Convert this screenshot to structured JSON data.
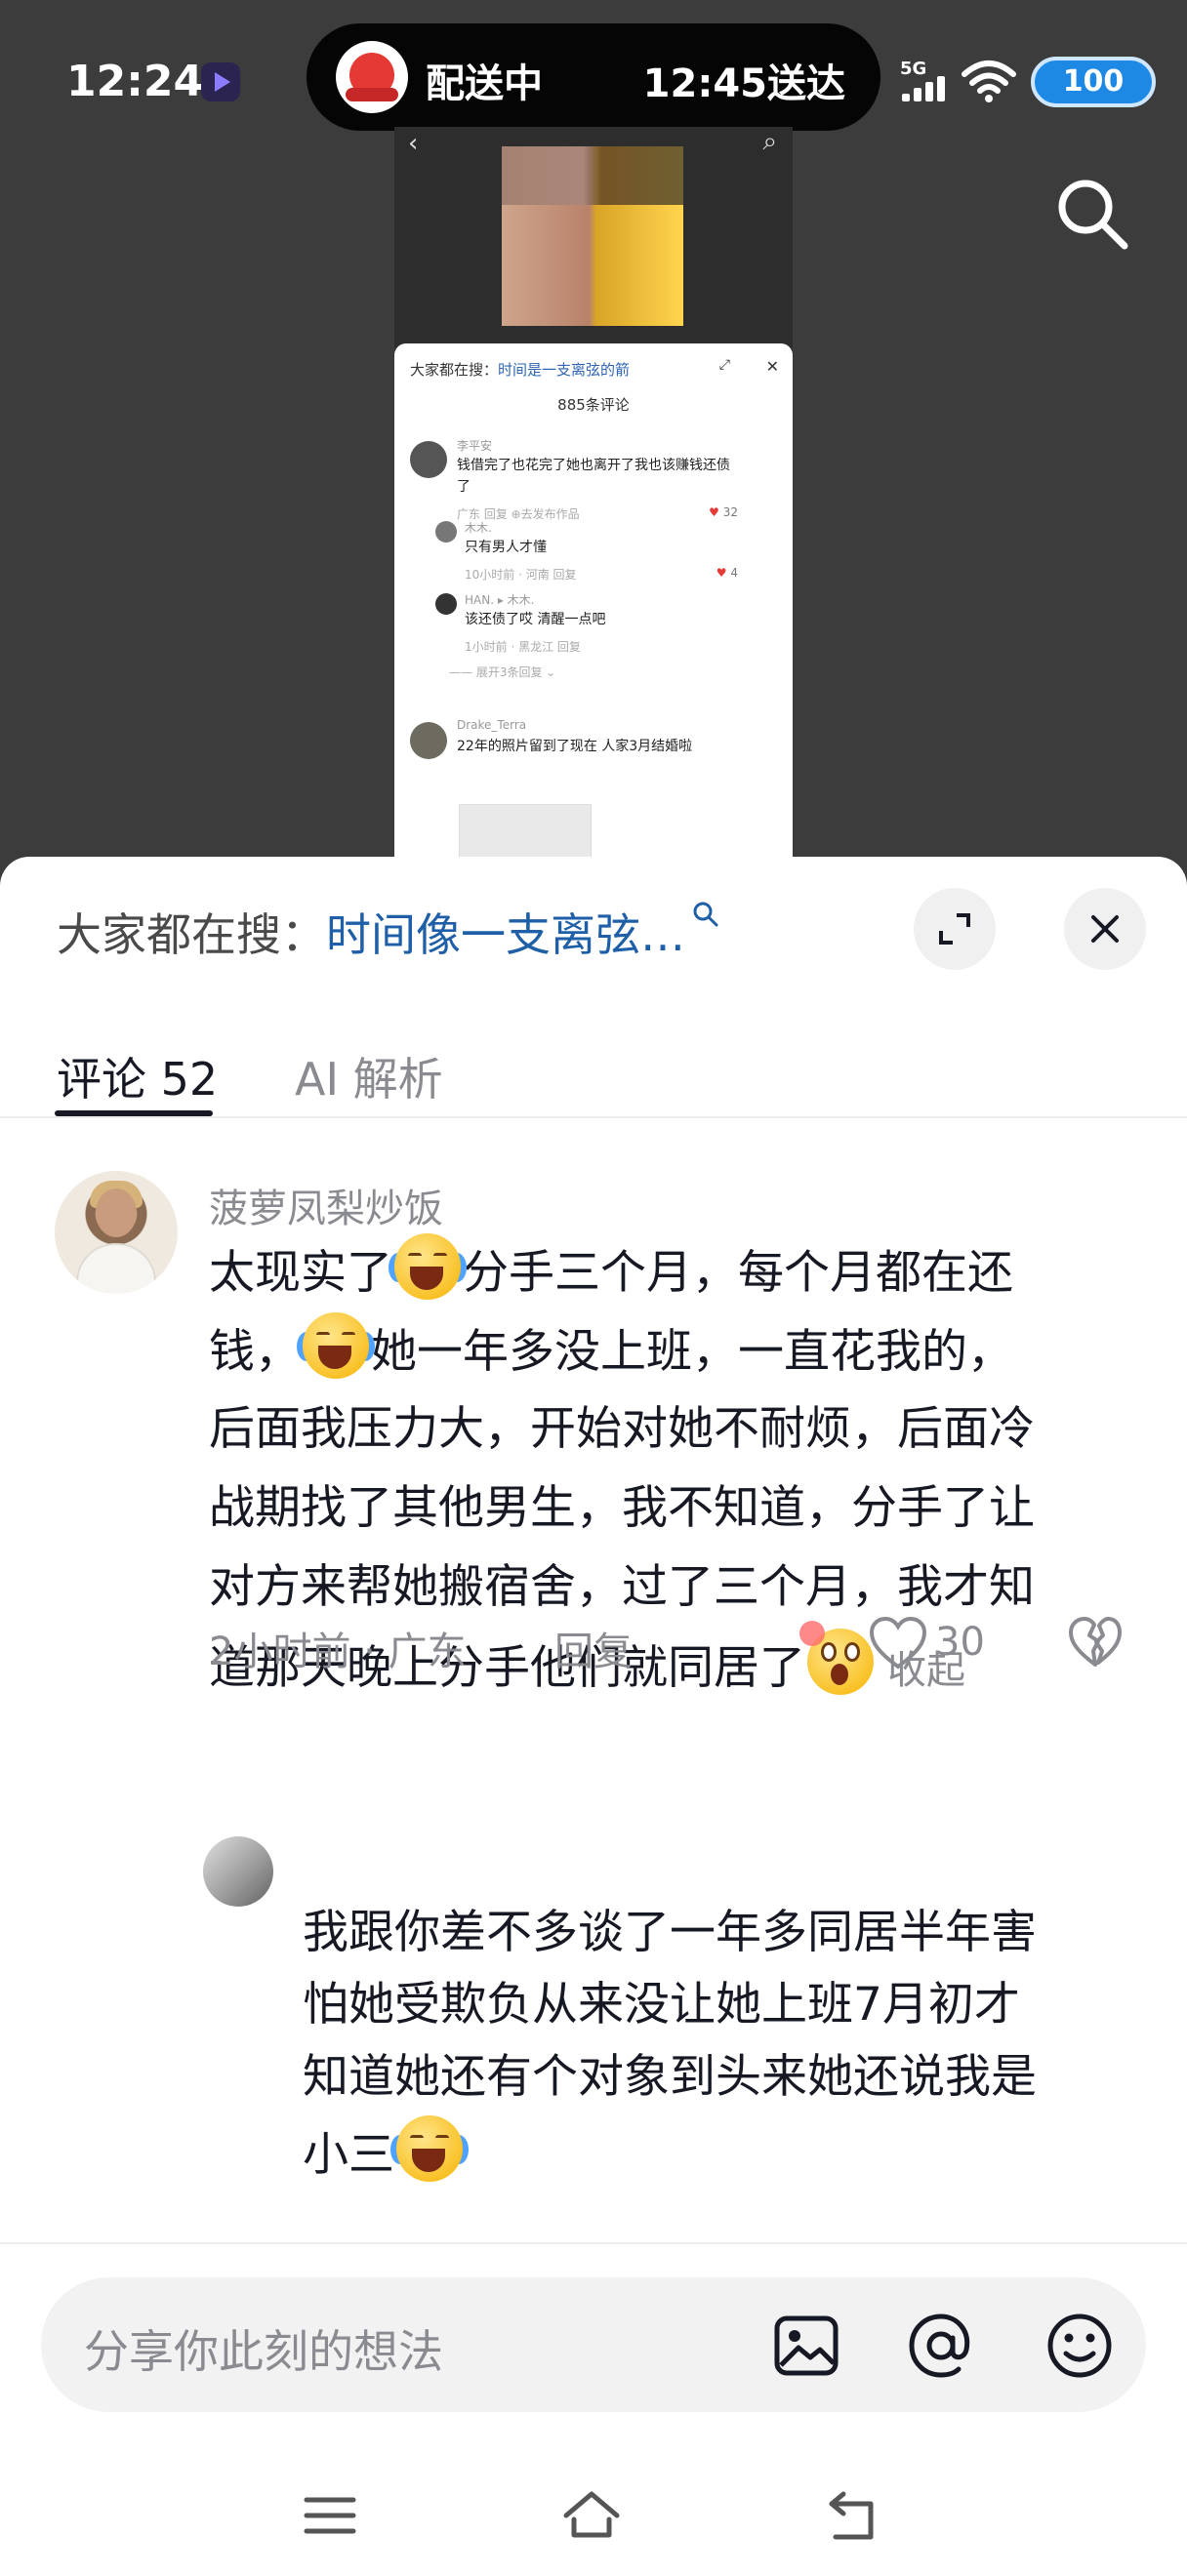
{
  "status_bar": {
    "time": "12:24",
    "network": "5G",
    "battery": "100"
  },
  "live_activity": {
    "status": "配送中",
    "eta": "12:45送达"
  },
  "background_preview": {
    "search_label": "大家都在搜：",
    "search_term": "时间是一支离弦的箭",
    "comment_count": "885条评论",
    "comments": [
      {
        "name": "李平安",
        "text_line1": "钱借完了也花完了她也离开了我也该赚钱还债",
        "text_line2": "了",
        "meta": "广东   回复   ⊕去发布作品",
        "likes": "32"
      },
      {
        "name": "木木.",
        "text_line1": "只有男人才懂",
        "meta": "10小时前 · 河南     回复",
        "likes": "4"
      },
      {
        "name": "HAN. ▸ 木木.",
        "text_line1": "该还债了哎 清醒一点吧",
        "meta": "1小时前 · 黑龙江     回复"
      },
      {
        "expand": "—— 展开3条回复 ⌄"
      },
      {
        "name": "Drake_Terra",
        "text_line1": "22年的照片留到了现在 人家3月结婚啦"
      }
    ]
  },
  "sheet": {
    "search_prefix": "大家都在搜：",
    "search_term": "时间像一支离弦…",
    "tabs": [
      {
        "label": "评论 52",
        "active": true
      },
      {
        "label": "AI 解析",
        "active": false
      }
    ]
  },
  "comment": {
    "username": "菠萝凤梨炒饭",
    "lines": [
      {
        "before": "太现实了",
        "emoji": "crying-laughing",
        "after": "分手三个月，每个月都在还"
      },
      {
        "before": "钱，",
        "emoji": "crying-laughing",
        "after": "她一年多没上班，一直花我的，"
      },
      {
        "before": "后面我压力大，开始对她不耐烦，后面冷"
      },
      {
        "before": "战期找了其他男生，我不知道，分手了让"
      },
      {
        "before": "对方来帮她搬宿舍，过了三个月，我才知"
      },
      {
        "before": "道那天晚上分手他们就同居了",
        "emoji": "shocked",
        "after": ""
      }
    ],
    "collapse_label": "收起",
    "time_location": "2小时前 · 广东",
    "reply_label": "回复",
    "likes": "30"
  },
  "reply": {
    "lines": [
      "我跟你差不多谈了一年多同居半年害",
      "怕她受欺负从来没让她上班7月初才",
      "知道她还有个对象到头来她还说我是"
    ],
    "last_line": "小三",
    "last_emoji": "crying-laughing",
    "meta_peek": "2小时前 · 广东 · 回复"
  },
  "input": {
    "placeholder": "分享你此刻的想法"
  },
  "icons": {
    "image": "image-icon",
    "mention": "at-icon",
    "emoji": "emoji-icon",
    "like": "heart-outline-icon",
    "dislike": "broken-heart-icon"
  },
  "colors": {
    "link_blue": "#1f5fa8",
    "battery_blue": "#1e88e5",
    "secondary_text": "#8a8b91"
  }
}
